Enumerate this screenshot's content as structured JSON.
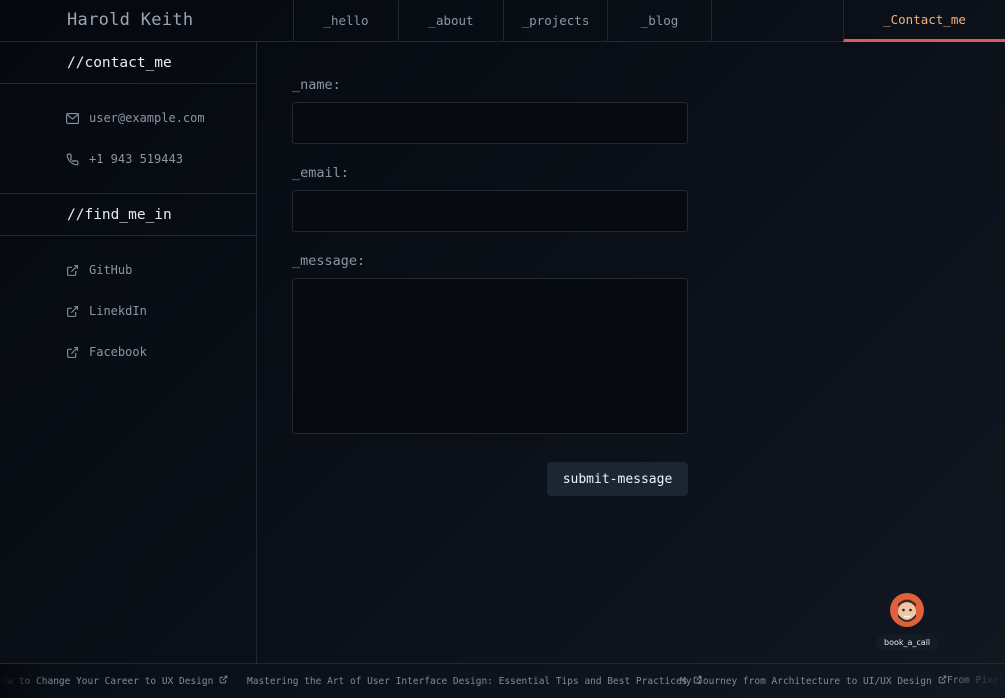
{
  "header": {
    "logo": "Harold Keith",
    "tabs": [
      "_hello",
      "_about",
      "_projects",
      "_blog"
    ],
    "active_tab": "_Contact_me"
  },
  "sidebar": {
    "contact_heading": "//contact_me",
    "email": "user@example.com",
    "phone": "+1 943 519443",
    "find_heading": "//find_me_in",
    "links": [
      "GitHub",
      "LinekdIn",
      "Facebook"
    ]
  },
  "form": {
    "name_label": "_name:",
    "email_label": "_email:",
    "message_label": "_message:",
    "submit_label": "submit-message"
  },
  "book_call": {
    "label": "book_a_call"
  },
  "ticker": {
    "items": [
      "How to Change Your Career to UX Design",
      "Mastering the Art of User Interface Design: Essential Tips and Best Practices",
      "My Journey from Architecture to UI/UX Design",
      "From Pixel"
    ]
  },
  "colors": {
    "accent": "#e2585b",
    "active_text": "#f4b07a",
    "avatar_bg": "#e0603d"
  }
}
